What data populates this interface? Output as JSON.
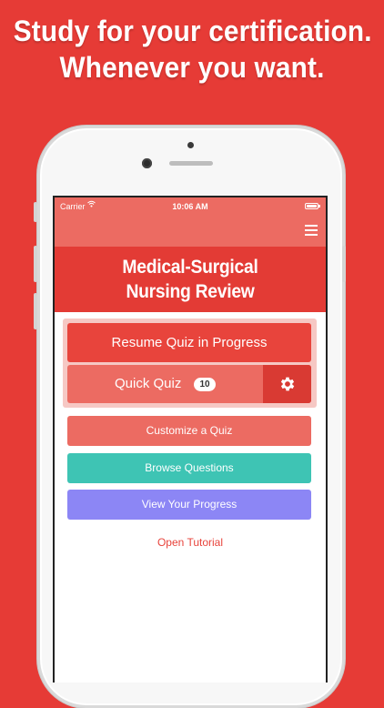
{
  "headline": {
    "line1": "Study for your certification.",
    "line2": "Whenever you want."
  },
  "status_bar": {
    "carrier": "Carrier",
    "time": "10:06 AM"
  },
  "app": {
    "title_line1": "Medical-Surgical",
    "title_line2": "Nursing Review"
  },
  "buttons": {
    "resume": "Resume Quiz in Progress",
    "quick_quiz": "Quick Quiz",
    "quick_quiz_count": "10",
    "customize": "Customize a Quiz",
    "browse": "Browse Questions",
    "progress": "View Your Progress",
    "tutorial": "Open Tutorial"
  },
  "colors": {
    "background": "#e63b36",
    "nav": "#ec6b62",
    "title_bar": "#e33b35",
    "resume": "#e8443c",
    "browse": "#3ec4b4",
    "progress": "#8c86f5"
  },
  "icons": [
    "wifi-icon",
    "battery-icon",
    "menu-icon",
    "gear-icon"
  ]
}
